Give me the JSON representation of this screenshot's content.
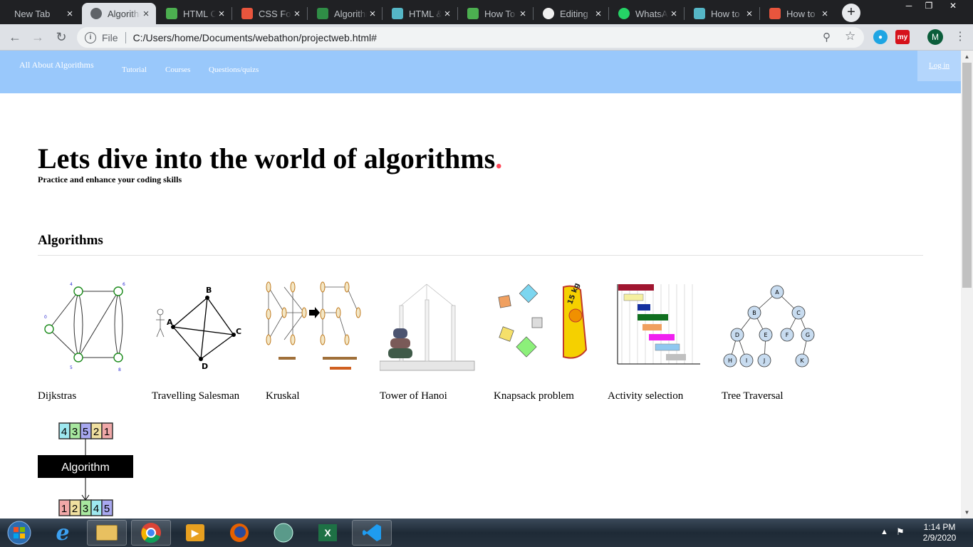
{
  "browser": {
    "tabs": [
      {
        "title": "New Tab",
        "icon": "blank-icon",
        "active": false
      },
      {
        "title": "Algorithms",
        "icon": "globe-icon",
        "active": true
      },
      {
        "title": "HTML Colors",
        "icon": "w3schools-icon",
        "active": false
      },
      {
        "title": "CSS Fonts",
        "icon": "asterisk-icon",
        "active": false
      },
      {
        "title": "Algorithms",
        "icon": "geeksforgeeks-icon",
        "active": false
      },
      {
        "title": "HTML & CSS",
        "icon": "site-icon",
        "active": false
      },
      {
        "title": "How To",
        "icon": "w3schools-icon",
        "active": false
      },
      {
        "title": "Editing",
        "icon": "github-icon",
        "active": false
      },
      {
        "title": "WhatsApp",
        "icon": "whatsapp-icon",
        "active": false
      },
      {
        "title": "How to",
        "icon": "site-icon",
        "active": false
      },
      {
        "title": "How to",
        "icon": "bookmark-icon",
        "active": false
      }
    ],
    "address": {
      "scheme_label": "File",
      "url": "C:/Users/home/Documents/webathon/projectweb.html#"
    },
    "profile_initial": "M",
    "ext_my_label": "my"
  },
  "site": {
    "nav": {
      "brand": "All About Algorithms",
      "links": [
        "Tutorial",
        "Courses",
        "Questions/quizs"
      ],
      "login": "Log in"
    },
    "hero": {
      "title": "Lets dive into the world of algorithms",
      "title_dot": ".",
      "subtitle": "Practice and enhance your coding skills"
    },
    "section": {
      "title": "Algorithms",
      "cards": [
        {
          "label": "Dijkstras"
        },
        {
          "label": "Travelling Salesman"
        },
        {
          "label": "Kruskal"
        },
        {
          "label": "Tower of Hanoi"
        },
        {
          "label": "Knapsack problem"
        },
        {
          "label": "Activity selection"
        },
        {
          "label": "Tree Traversal"
        }
      ],
      "sort_figure": {
        "input": [
          "4",
          "3",
          "5",
          "2",
          "1"
        ],
        "box_label": "Algorithm",
        "output": [
          "1",
          "2",
          "3",
          "4",
          "5"
        ]
      }
    },
    "tsp_nodes": [
      "A",
      "B",
      "C",
      "D"
    ],
    "tree_nodes": [
      "A",
      "B",
      "C",
      "D",
      "E",
      "F",
      "G",
      "H",
      "I",
      "J",
      "K"
    ],
    "knapsack_weight": "15 kg"
  },
  "taskbar": {
    "time": "1:14 PM",
    "date": "2/9/2020"
  },
  "colors": {
    "nav_bg": "#99c8fb",
    "accent_dot": "#ff4757",
    "chrome_dark": "#202124"
  }
}
